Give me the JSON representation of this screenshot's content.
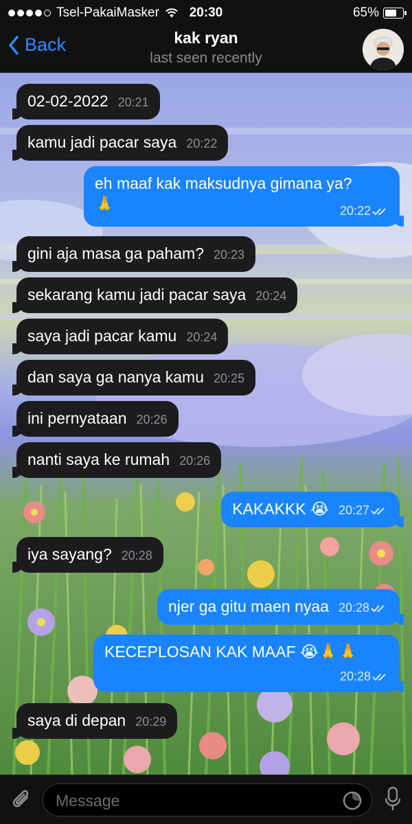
{
  "status": {
    "carrier": "Tsel-PakaiMasker",
    "time": "20:30",
    "battery": "65%",
    "battery_level": 0.65
  },
  "nav": {
    "back_label": "Back",
    "title": "kak ryan",
    "subtitle": "last seen recently"
  },
  "messages": [
    {
      "dir": "in",
      "text": "02-02-2022",
      "time": "20:21"
    },
    {
      "dir": "in",
      "text": "kamu jadi pacar saya",
      "time": "20:22"
    },
    {
      "dir": "out",
      "text": "eh maaf kak maksudnya gimana ya?",
      "text2": "🙏",
      "time": "20:22"
    },
    {
      "dir": "in",
      "text": "gini aja masa ga paham?",
      "time": "20:23"
    },
    {
      "dir": "in",
      "text": "sekarang kamu jadi pacar saya",
      "time": "20:24"
    },
    {
      "dir": "in",
      "text": "saya jadi pacar kamu",
      "time": "20:24"
    },
    {
      "dir": "in",
      "text": "dan saya ga nanya kamu",
      "time": "20:25"
    },
    {
      "dir": "in",
      "text": "ini pernyataan",
      "time": "20:26"
    },
    {
      "dir": "in",
      "text": "nanti saya ke rumah",
      "time": "20:26"
    },
    {
      "dir": "out",
      "text": "KAKAKKK 😭",
      "time": "20:27"
    },
    {
      "dir": "in",
      "text": "iya sayang?",
      "time": "20:28"
    },
    {
      "dir": "out",
      "text": "njer ga gitu maen nyaa",
      "time": "20:28"
    },
    {
      "dir": "out",
      "text": "KECEPLOSAN KAK MAAF 😭🙏🙏",
      "time": "20:28"
    },
    {
      "dir": "in",
      "text": "saya di depan",
      "time": "20:29"
    }
  ],
  "input": {
    "placeholder": "Message"
  },
  "colors": {
    "accent": "#1a84ff",
    "incoming": "#1c1c1e",
    "bar": "#111111"
  },
  "icons": {
    "attach": "paperclip-icon",
    "sticker": "sticker-icon",
    "mic": "microphone-icon",
    "back": "chevron-left-icon",
    "read": "double-check-icon"
  }
}
